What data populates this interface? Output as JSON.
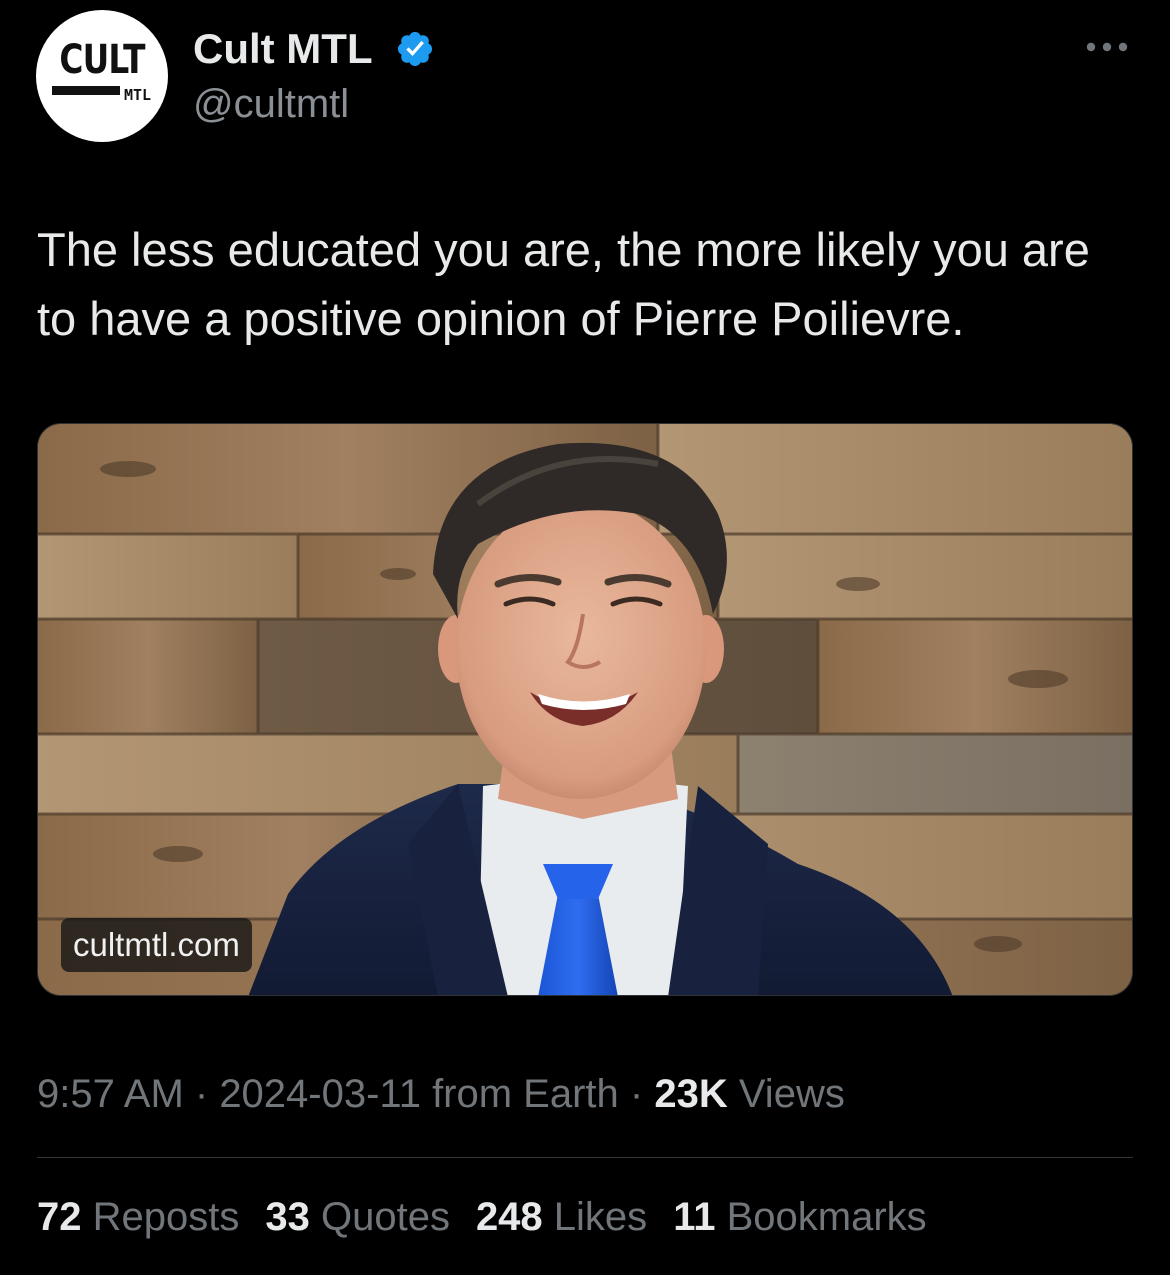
{
  "account": {
    "display_name": "Cult MTL",
    "handle": "@cultmtl",
    "verified": true,
    "avatar_logo_top": "CULT",
    "avatar_logo_bottom": "MTL",
    "verified_color": "#1d9bf0"
  },
  "header": {
    "more_icon": "more-horizontal-icon"
  },
  "tweet": {
    "text": "The less educated you are, the more likely you are to have a positive opinion of Pierre Poilievre."
  },
  "media": {
    "link_domain": "cultmtl.com"
  },
  "meta": {
    "time": "9:57 AM",
    "separator": " · ",
    "date": "2024-03-11",
    "source": " from Earth",
    "views_count": "23K",
    "views_label": " Views"
  },
  "stats": {
    "reposts_count": "72",
    "reposts_label": " Reposts",
    "quotes_count": "33",
    "quotes_label": " Quotes",
    "likes_count": "248",
    "likes_label": " Likes",
    "bookmarks_count": "11",
    "bookmarks_label": " Bookmarks"
  },
  "colors": {
    "background": "#000000",
    "text_primary": "#e7e9ea",
    "text_secondary": "#71767b",
    "divider": "#2f3336",
    "accent": "#1d9bf0"
  }
}
